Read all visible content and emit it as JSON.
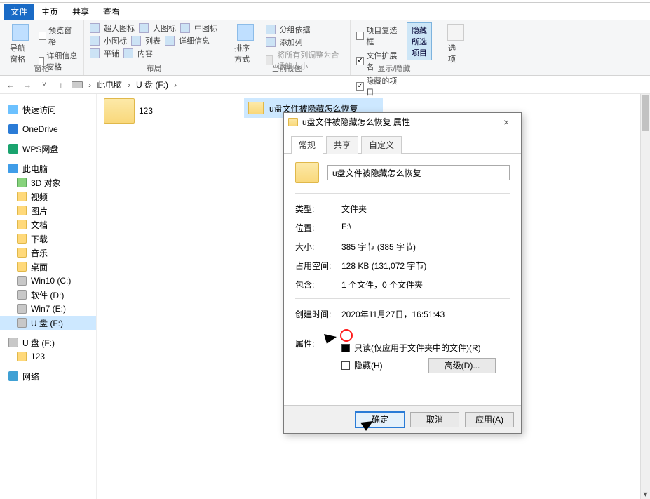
{
  "ribbon_tabs": {
    "file": "文件",
    "home": "主页",
    "share": "共享",
    "view": "查看"
  },
  "ribbon": {
    "panes": {
      "nav": "导航窗格",
      "preview_chk": "预览窗格",
      "details_chk": "详细信息窗格",
      "group_label": "窗格"
    },
    "layout": {
      "xl_icons": "超大图标",
      "l_icons": "大图标",
      "m_icons": "中图标",
      "s_icons": "小图标",
      "list": "列表",
      "details": "详细信息",
      "tiles": "平铺",
      "content": "内容",
      "group_label": "布局"
    },
    "view": {
      "sort": "排序方式",
      "groupby": "分组依据",
      "addcol": "添加列",
      "autosize": "将所有列调整为合适的大小",
      "group_label": "当前视图"
    },
    "showhide": {
      "item_chk": "项目复选框",
      "ext_chk": "文件扩展名",
      "hidden_chk": "隐藏的项目",
      "hide_btn_l1": "隐藏",
      "hide_btn_l2": "所选项目",
      "group_label": "显示/隐藏"
    },
    "options": "选项"
  },
  "breadcrumb": {
    "pc": "此电脑",
    "drive": "U 盘 (F:)"
  },
  "sidebar": {
    "quick": "快速访问",
    "onedrive": "OneDrive",
    "wps": "WPS网盘",
    "thispc": "此电脑",
    "obj3d": "3D 对象",
    "video": "视频",
    "pic": "图片",
    "doc": "文档",
    "dl": "下载",
    "music": "音乐",
    "desktop": "桌面",
    "win10": "Win10 (C:)",
    "soft": "软件 (D:)",
    "win7": "Win7 (E:)",
    "udrive": "U 盘 (F:)",
    "udrive2": "U 盘 (F:)",
    "folder123": "123",
    "network": "网络"
  },
  "files": {
    "f1": "123",
    "f2": "u盘文件被隐藏怎么恢复"
  },
  "dialog": {
    "title": "u盘文件被隐藏怎么恢复 属性",
    "tabs": {
      "general": "常规",
      "share": "共享",
      "custom": "自定义"
    },
    "name_value": "u盘文件被隐藏怎么恢复",
    "rows": {
      "type_l": "类型:",
      "type_v": "文件夹",
      "loc_l": "位置:",
      "loc_v": "F:\\",
      "size_l": "大小:",
      "size_v": "385 字节 (385 字节)",
      "disk_l": "占用空间:",
      "disk_v": "128 KB (131,072 字节)",
      "contains_l": "包含:",
      "contains_v": "1 个文件，0 个文件夹",
      "created_l": "创建时间:",
      "created_v": "2020年11月27日，16:51:43",
      "attr_l": "属性:"
    },
    "attrs": {
      "readonly": "只读(仅应用于文件夹中的文件)(R)",
      "hidden": "隐藏(H)",
      "advanced": "高级(D)..."
    },
    "buttons": {
      "ok": "确定",
      "cancel": "取消",
      "apply": "应用(A)"
    }
  }
}
